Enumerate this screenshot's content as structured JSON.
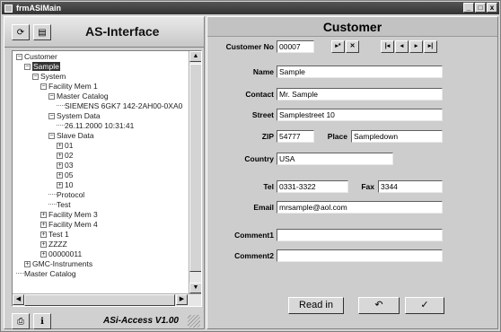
{
  "window": {
    "title": "frmASIMain",
    "min": "_",
    "max": "□",
    "close": "x"
  },
  "left": {
    "title": "AS-Interface",
    "version": "ASi-Access V1.00",
    "tree": [
      {
        "label": "Customer",
        "level": 0,
        "exp": "−"
      },
      {
        "label": "Sample",
        "level": 1,
        "exp": "−",
        "selected": true
      },
      {
        "label": "System",
        "level": 2,
        "exp": "−"
      },
      {
        "label": "Facility Mem 1",
        "level": 3,
        "exp": "−"
      },
      {
        "label": "Master Catalog",
        "level": 4,
        "exp": "−"
      },
      {
        "label": "SIEMENS 6GK7 142-2AH00-0XA0",
        "level": 5,
        "exp": ""
      },
      {
        "label": "System Data",
        "level": 4,
        "exp": "−"
      },
      {
        "label": "26.11.2000 10:31:41",
        "level": 5,
        "exp": ""
      },
      {
        "label": "Slave Data",
        "level": 4,
        "exp": "−"
      },
      {
        "label": "01",
        "level": 5,
        "exp": "+"
      },
      {
        "label": "02",
        "level": 5,
        "exp": "+"
      },
      {
        "label": "03",
        "level": 5,
        "exp": "+"
      },
      {
        "label": "05",
        "level": 5,
        "exp": "+"
      },
      {
        "label": "10",
        "level": 5,
        "exp": "+"
      },
      {
        "label": "Protocol",
        "level": 4,
        "exp": ""
      },
      {
        "label": "Test",
        "level": 4,
        "exp": ""
      },
      {
        "label": "Facility Mem 3",
        "level": 3,
        "exp": "+"
      },
      {
        "label": "Facility Mem 4",
        "level": 3,
        "exp": "+"
      },
      {
        "label": "Test 1",
        "level": 3,
        "exp": "+"
      },
      {
        "label": "ZZZZ",
        "level": 3,
        "exp": "+"
      },
      {
        "label": "00000011",
        "level": 3,
        "exp": "+"
      },
      {
        "label": "GMC-Instruments",
        "level": 1,
        "exp": "+"
      },
      {
        "label": "Master Catalog",
        "level": 0,
        "exp": ""
      }
    ]
  },
  "right": {
    "title": "Customer",
    "labels": {
      "customer_no": "Customer No",
      "name": "Name",
      "contact": "Contact",
      "street": "Street",
      "zip": "ZIP",
      "place": "Place",
      "country": "Country",
      "tel": "Tel",
      "fax": "Fax",
      "email": "Email",
      "comment1": "Comment1",
      "comment2": "Comment2"
    },
    "values": {
      "customer_no": "00007",
      "name": "Sample",
      "contact": "Mr. Sample",
      "street": "Samplestreet 10",
      "zip": "54777",
      "place": "Sampledown",
      "country": "USA",
      "tel": "0331-3322",
      "fax": "3344",
      "email": "mrsample@aol.com",
      "comment1": "",
      "comment2": ""
    },
    "nav": [
      "▸*",
      "✕",
      "|◂",
      "◂",
      "▸",
      "▸|"
    ],
    "buttons": {
      "read_in": "Read in",
      "undo": "↶",
      "ok": "✓"
    }
  }
}
